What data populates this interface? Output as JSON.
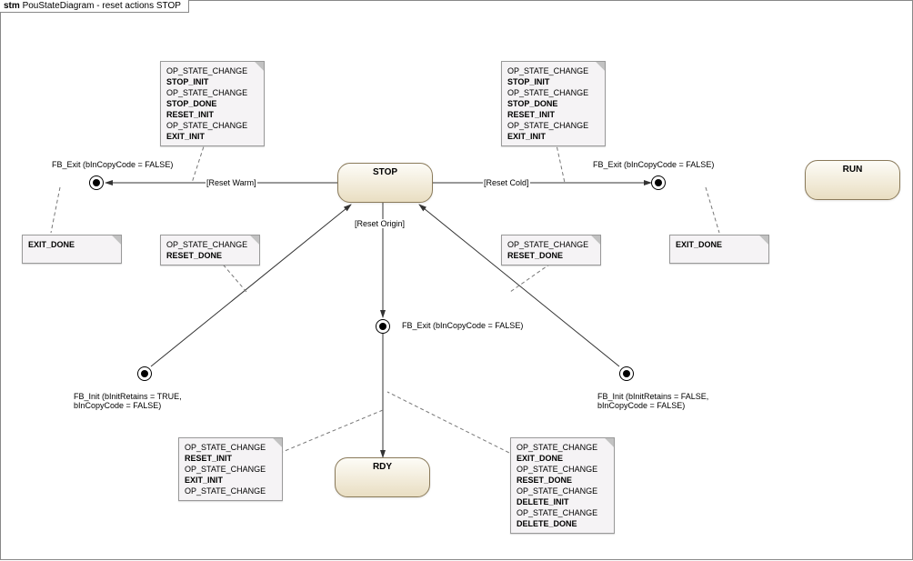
{
  "title_prefix": "stm",
  "title_main": "PouStateDiagram - reset actions STOP",
  "states": {
    "stop": "STOP",
    "rdy": "RDY",
    "run": "RUN"
  },
  "guards": {
    "reset_warm": "[Reset Warm]",
    "reset_cold": "[Reset Cold]",
    "reset_origin": "[Reset Origin]"
  },
  "labels": {
    "fb_exit_left": "FB_Exit (bInCopyCode = FALSE)",
    "fb_exit_right": "FB_Exit (bInCopyCode = FALSE)",
    "fb_exit_mid": "FB_Exit (bInCopyCode = FALSE)",
    "fb_init_left": "FB_Init (bInitRetains = TRUE,\nbInCopyCode = FALSE)",
    "fb_init_right": "FB_Init (bInitRetains = FALSE,\nbInCopyCode = FALSE)"
  },
  "notes": {
    "top_left": [
      {
        "t": "OP_STATE_CHANGE"
      },
      {
        "t": "STOP_INIT",
        "b": 1
      },
      {
        "t": "OP_STATE_CHANGE"
      },
      {
        "t": "STOP_DONE",
        "b": 1
      },
      {
        "t": "RESET_INIT",
        "b": 1
      },
      {
        "t": "OP_STATE_CHANGE"
      },
      {
        "t": "EXIT_INIT",
        "b": 1
      }
    ],
    "top_right": [
      {
        "t": "OP_STATE_CHANGE"
      },
      {
        "t": "STOP_INIT",
        "b": 1
      },
      {
        "t": "OP_STATE_CHANGE"
      },
      {
        "t": "STOP_DONE",
        "b": 1
      },
      {
        "t": "RESET_INIT",
        "b": 1
      },
      {
        "t": "OP_STATE_CHANGE"
      },
      {
        "t": "EXIT_INIT",
        "b": 1
      }
    ],
    "exit_done_left": [
      {
        "t": "EXIT_DONE",
        "b": 1
      }
    ],
    "exit_done_right": [
      {
        "t": "EXIT_DONE",
        "b": 1
      }
    ],
    "reset_done_left": [
      {
        "t": "OP_STATE_CHANGE"
      },
      {
        "t": "RESET_DONE",
        "b": 1
      }
    ],
    "reset_done_right": [
      {
        "t": "OP_STATE_CHANGE"
      },
      {
        "t": "RESET_DONE",
        "b": 1
      }
    ],
    "bottom_left": [
      {
        "t": "OP_STATE_CHANGE"
      },
      {
        "t": "RESET_INIT",
        "b": 1
      },
      {
        "t": "OP_STATE_CHANGE"
      },
      {
        "t": "EXIT_INIT",
        "b": 1
      },
      {
        "t": "OP_STATE_CHANGE"
      }
    ],
    "bottom_right": [
      {
        "t": "OP_STATE_CHANGE"
      },
      {
        "t": "EXIT_DONE",
        "b": 1
      },
      {
        "t": "OP_STATE_CHANGE"
      },
      {
        "t": "RESET_DONE",
        "b": 1
      },
      {
        "t": "OP_STATE_CHANGE"
      },
      {
        "t": "DELETE_INIT",
        "b": 1
      },
      {
        "t": "OP_STATE_CHANGE"
      },
      {
        "t": "DELETE_DONE",
        "b": 1
      }
    ]
  }
}
